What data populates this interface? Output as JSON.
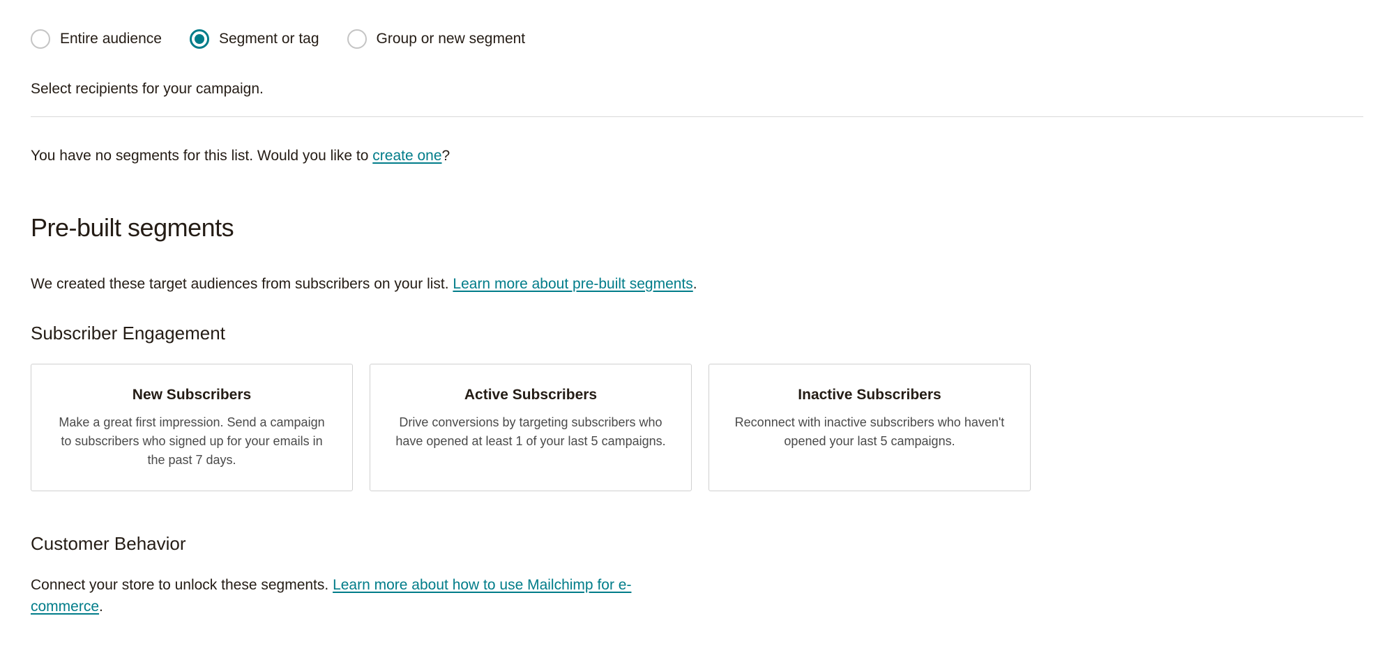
{
  "radios": {
    "entire": "Entire audience",
    "segment": "Segment or tag",
    "group": "Group or new segment"
  },
  "helper": "Select recipients for your campaign.",
  "noSegments": {
    "prefix": "You have no segments for this list. Would you like to ",
    "link": "create one",
    "suffix": "?"
  },
  "prebuilt": {
    "title": "Pre-built segments",
    "descPrefix": "We created these target audiences from subscribers on your list. ",
    "descLink": "Learn more about pre-built segments",
    "descSuffix": "."
  },
  "engagement": {
    "title": "Subscriber Engagement",
    "cards": [
      {
        "title": "New Subscribers",
        "desc": "Make a great first impression. Send a campaign to subscribers who signed up for your emails in the past 7 days."
      },
      {
        "title": "Active Subscribers",
        "desc": "Drive conversions by targeting subscribers who have opened at least 1 of your last 5 campaigns."
      },
      {
        "title": "Inactive Subscribers",
        "desc": "Reconnect with inactive subscribers who haven't opened your last 5 campaigns."
      }
    ]
  },
  "behavior": {
    "title": "Customer Behavior",
    "descPrefix": "Connect your store to unlock these segments. ",
    "descLink": "Learn more about how to use Mailchimp for e-commerce",
    "descSuffix": "."
  }
}
